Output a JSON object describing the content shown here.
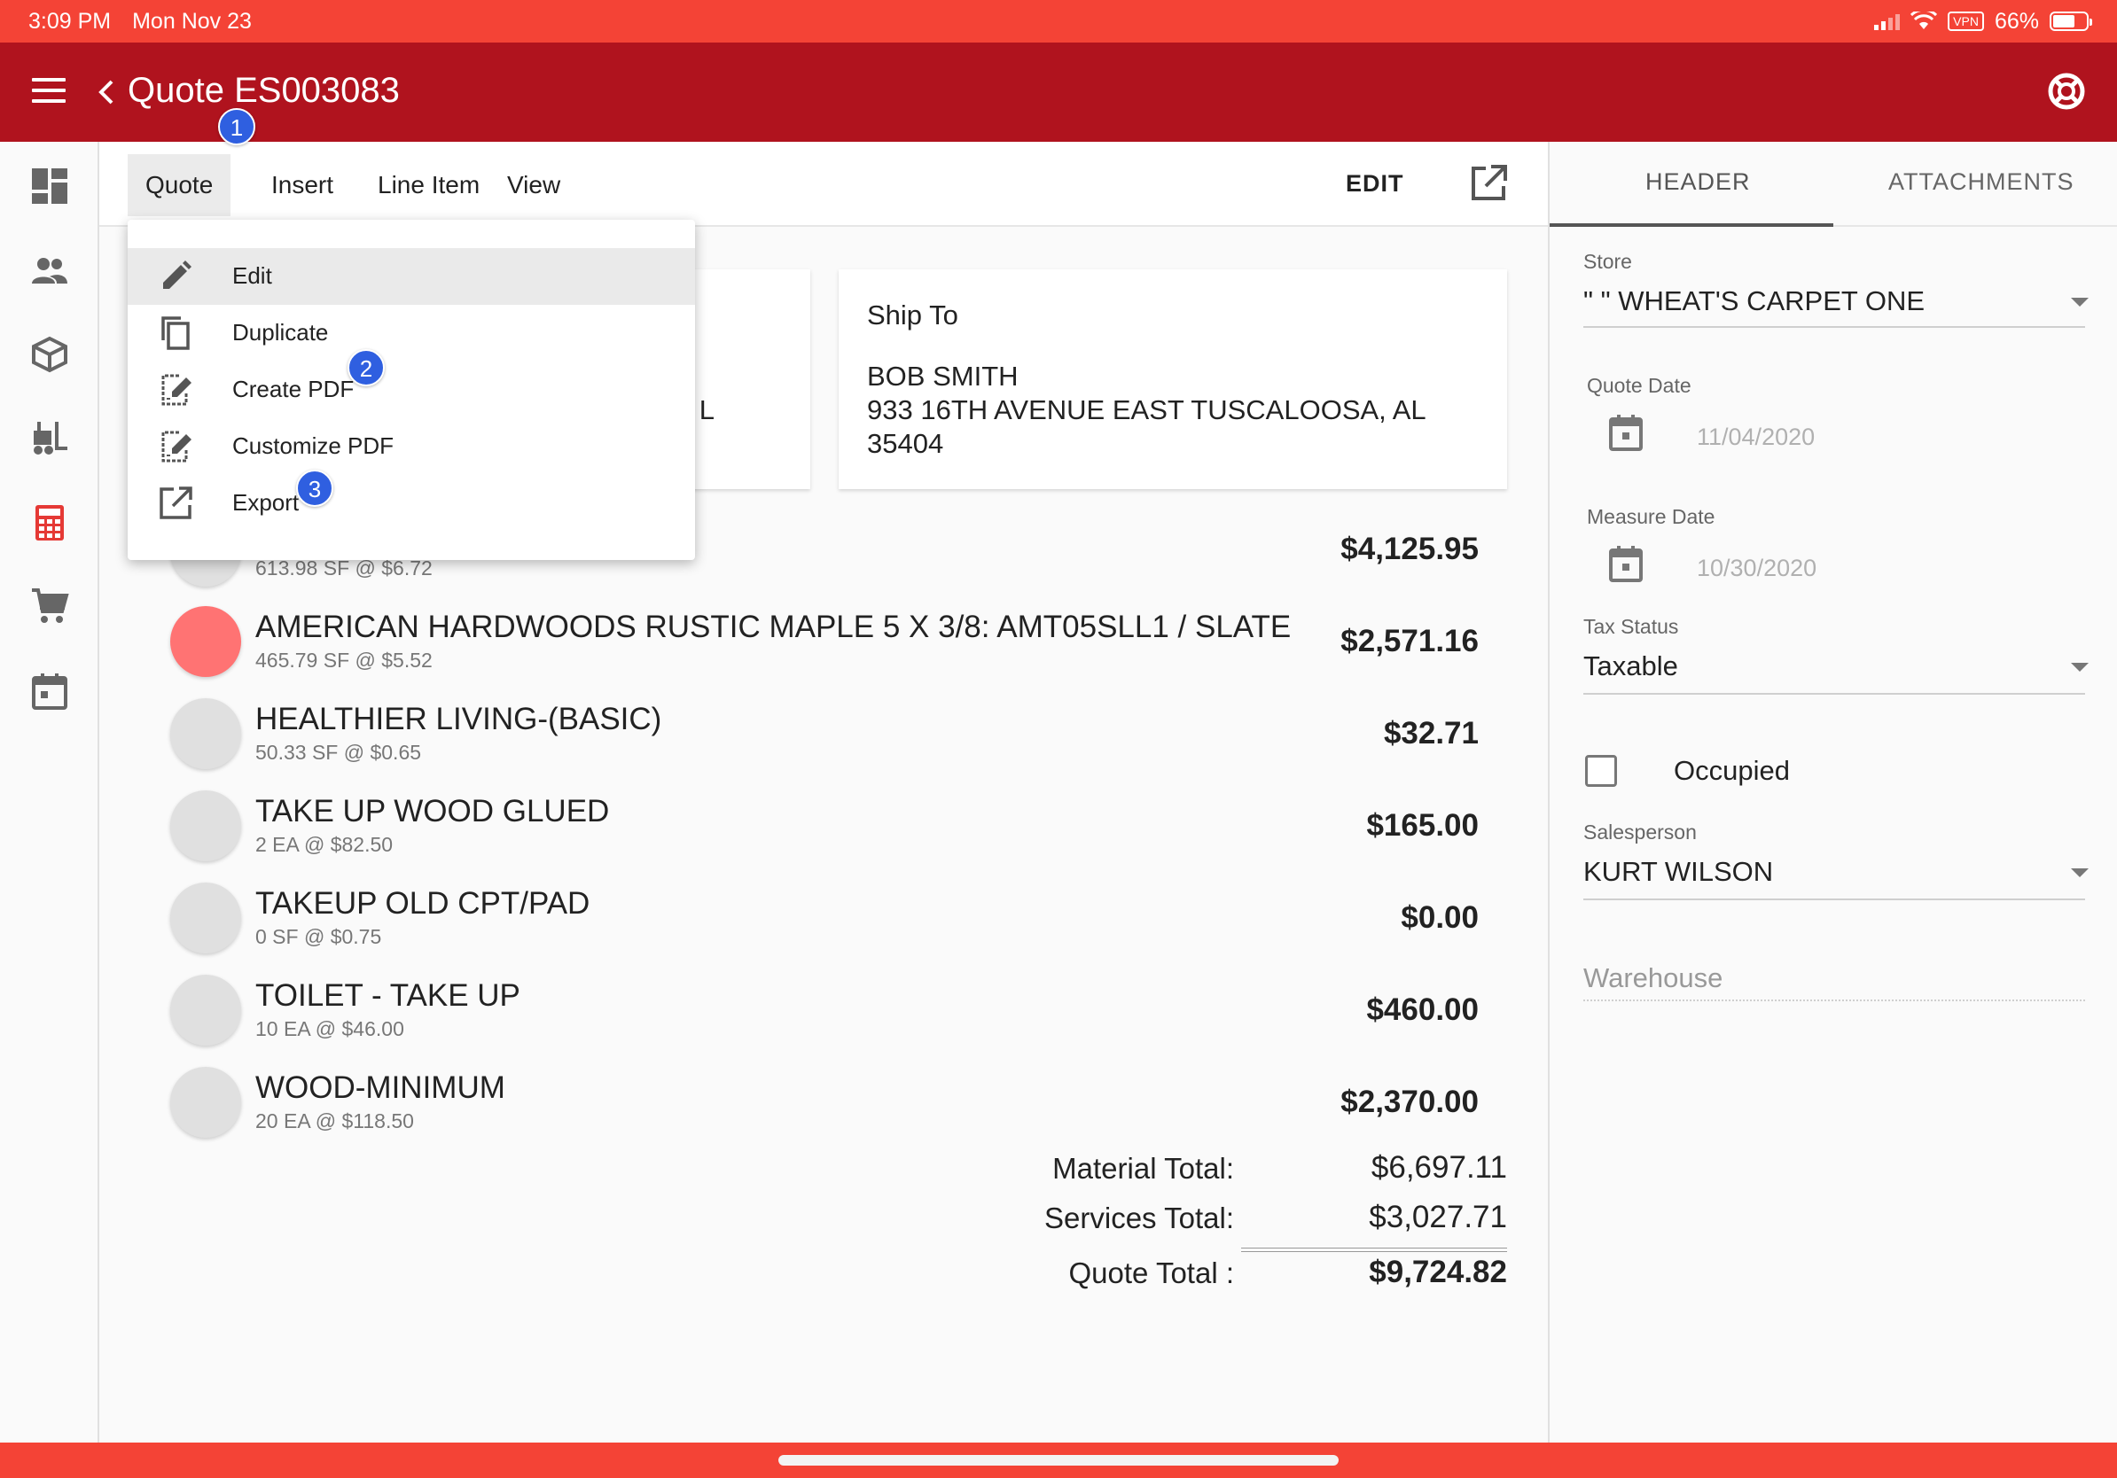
{
  "status_bar": {
    "time": "3:09 PM",
    "date": "Mon Nov 23",
    "vpn": "VPN",
    "battery": "66%"
  },
  "app_bar": {
    "title": "Quote ES003083"
  },
  "toolbar": {
    "menus": [
      "Quote",
      "Insert",
      "Line Item",
      "View"
    ],
    "edit_label": "EDIT"
  },
  "quote_menu": {
    "items": [
      {
        "label": "Edit",
        "icon": "pencil-icon"
      },
      {
        "label": "Duplicate",
        "icon": "copy-icon"
      },
      {
        "label": "Create PDF",
        "icon": "pdf-edit-icon"
      },
      {
        "label": "Customize PDF",
        "icon": "pdf-edit-icon"
      },
      {
        "label": "Export",
        "icon": "export-icon"
      }
    ]
  },
  "bill_to": {
    "partial_text": "L"
  },
  "ship_to": {
    "title": "Ship To",
    "name": "BOB SMITH",
    "address_line1": "933 16TH AVENUE EAST TUSCALOOSA, AL",
    "address_line2": "35404"
  },
  "line_items": [
    {
      "name": "",
      "detail": "613.98 SF @ $6.72",
      "price": "$4,125.95"
    },
    {
      "name": "AMERICAN HARDWOODS RUSTIC MAPLE 5 X 3/8: AMT05SLL1 / SLATE",
      "detail": "465.79 SF @ $5.52",
      "price": "$2,571.16"
    },
    {
      "name": "HEALTHIER LIVING-(BASIC)",
      "detail": "50.33 SF @ $0.65",
      "price": "$32.71"
    },
    {
      "name": "TAKE UP WOOD GLUED",
      "detail": "2 EA @ $82.50",
      "price": "$165.00"
    },
    {
      "name": "TAKEUP OLD CPT/PAD",
      "detail": "0 SF @ $0.75",
      "price": "$0.00"
    },
    {
      "name": "TOILET - TAKE UP",
      "detail": "10 EA @ $46.00",
      "price": "$460.00"
    },
    {
      "name": "WOOD-MINIMUM",
      "detail": "20 EA @ $118.50",
      "price": "$2,370.00"
    }
  ],
  "totals": {
    "material_label": "Material Total:",
    "material_value": "$6,697.11",
    "services_label": "Services Total:",
    "services_value": "$3,027.71",
    "quote_label": "Quote Total :",
    "quote_value": "$9,724.82"
  },
  "right_panel": {
    "tabs": [
      "HEADER",
      "ATTACHMENTS"
    ],
    "store_label": "Store",
    "store_value": "\" \" WHEAT'S CARPET ONE",
    "quote_date_label": "Quote Date",
    "quote_date_value": "11/04/2020",
    "measure_date_label": "Measure Date",
    "measure_date_value": "10/30/2020",
    "tax_status_label": "Tax Status",
    "tax_status_value": "Taxable",
    "occupied_label": "Occupied",
    "salesperson_label": "Salesperson",
    "salesperson_value": "KURT WILSON",
    "warehouse_placeholder": "Warehouse"
  },
  "annotations": [
    "1",
    "2",
    "3"
  ],
  "colors": {
    "status_bar": "#f44336",
    "app_bar": "#b0131e",
    "badge": "#2f5fe0",
    "accent_red": "#e53935"
  }
}
